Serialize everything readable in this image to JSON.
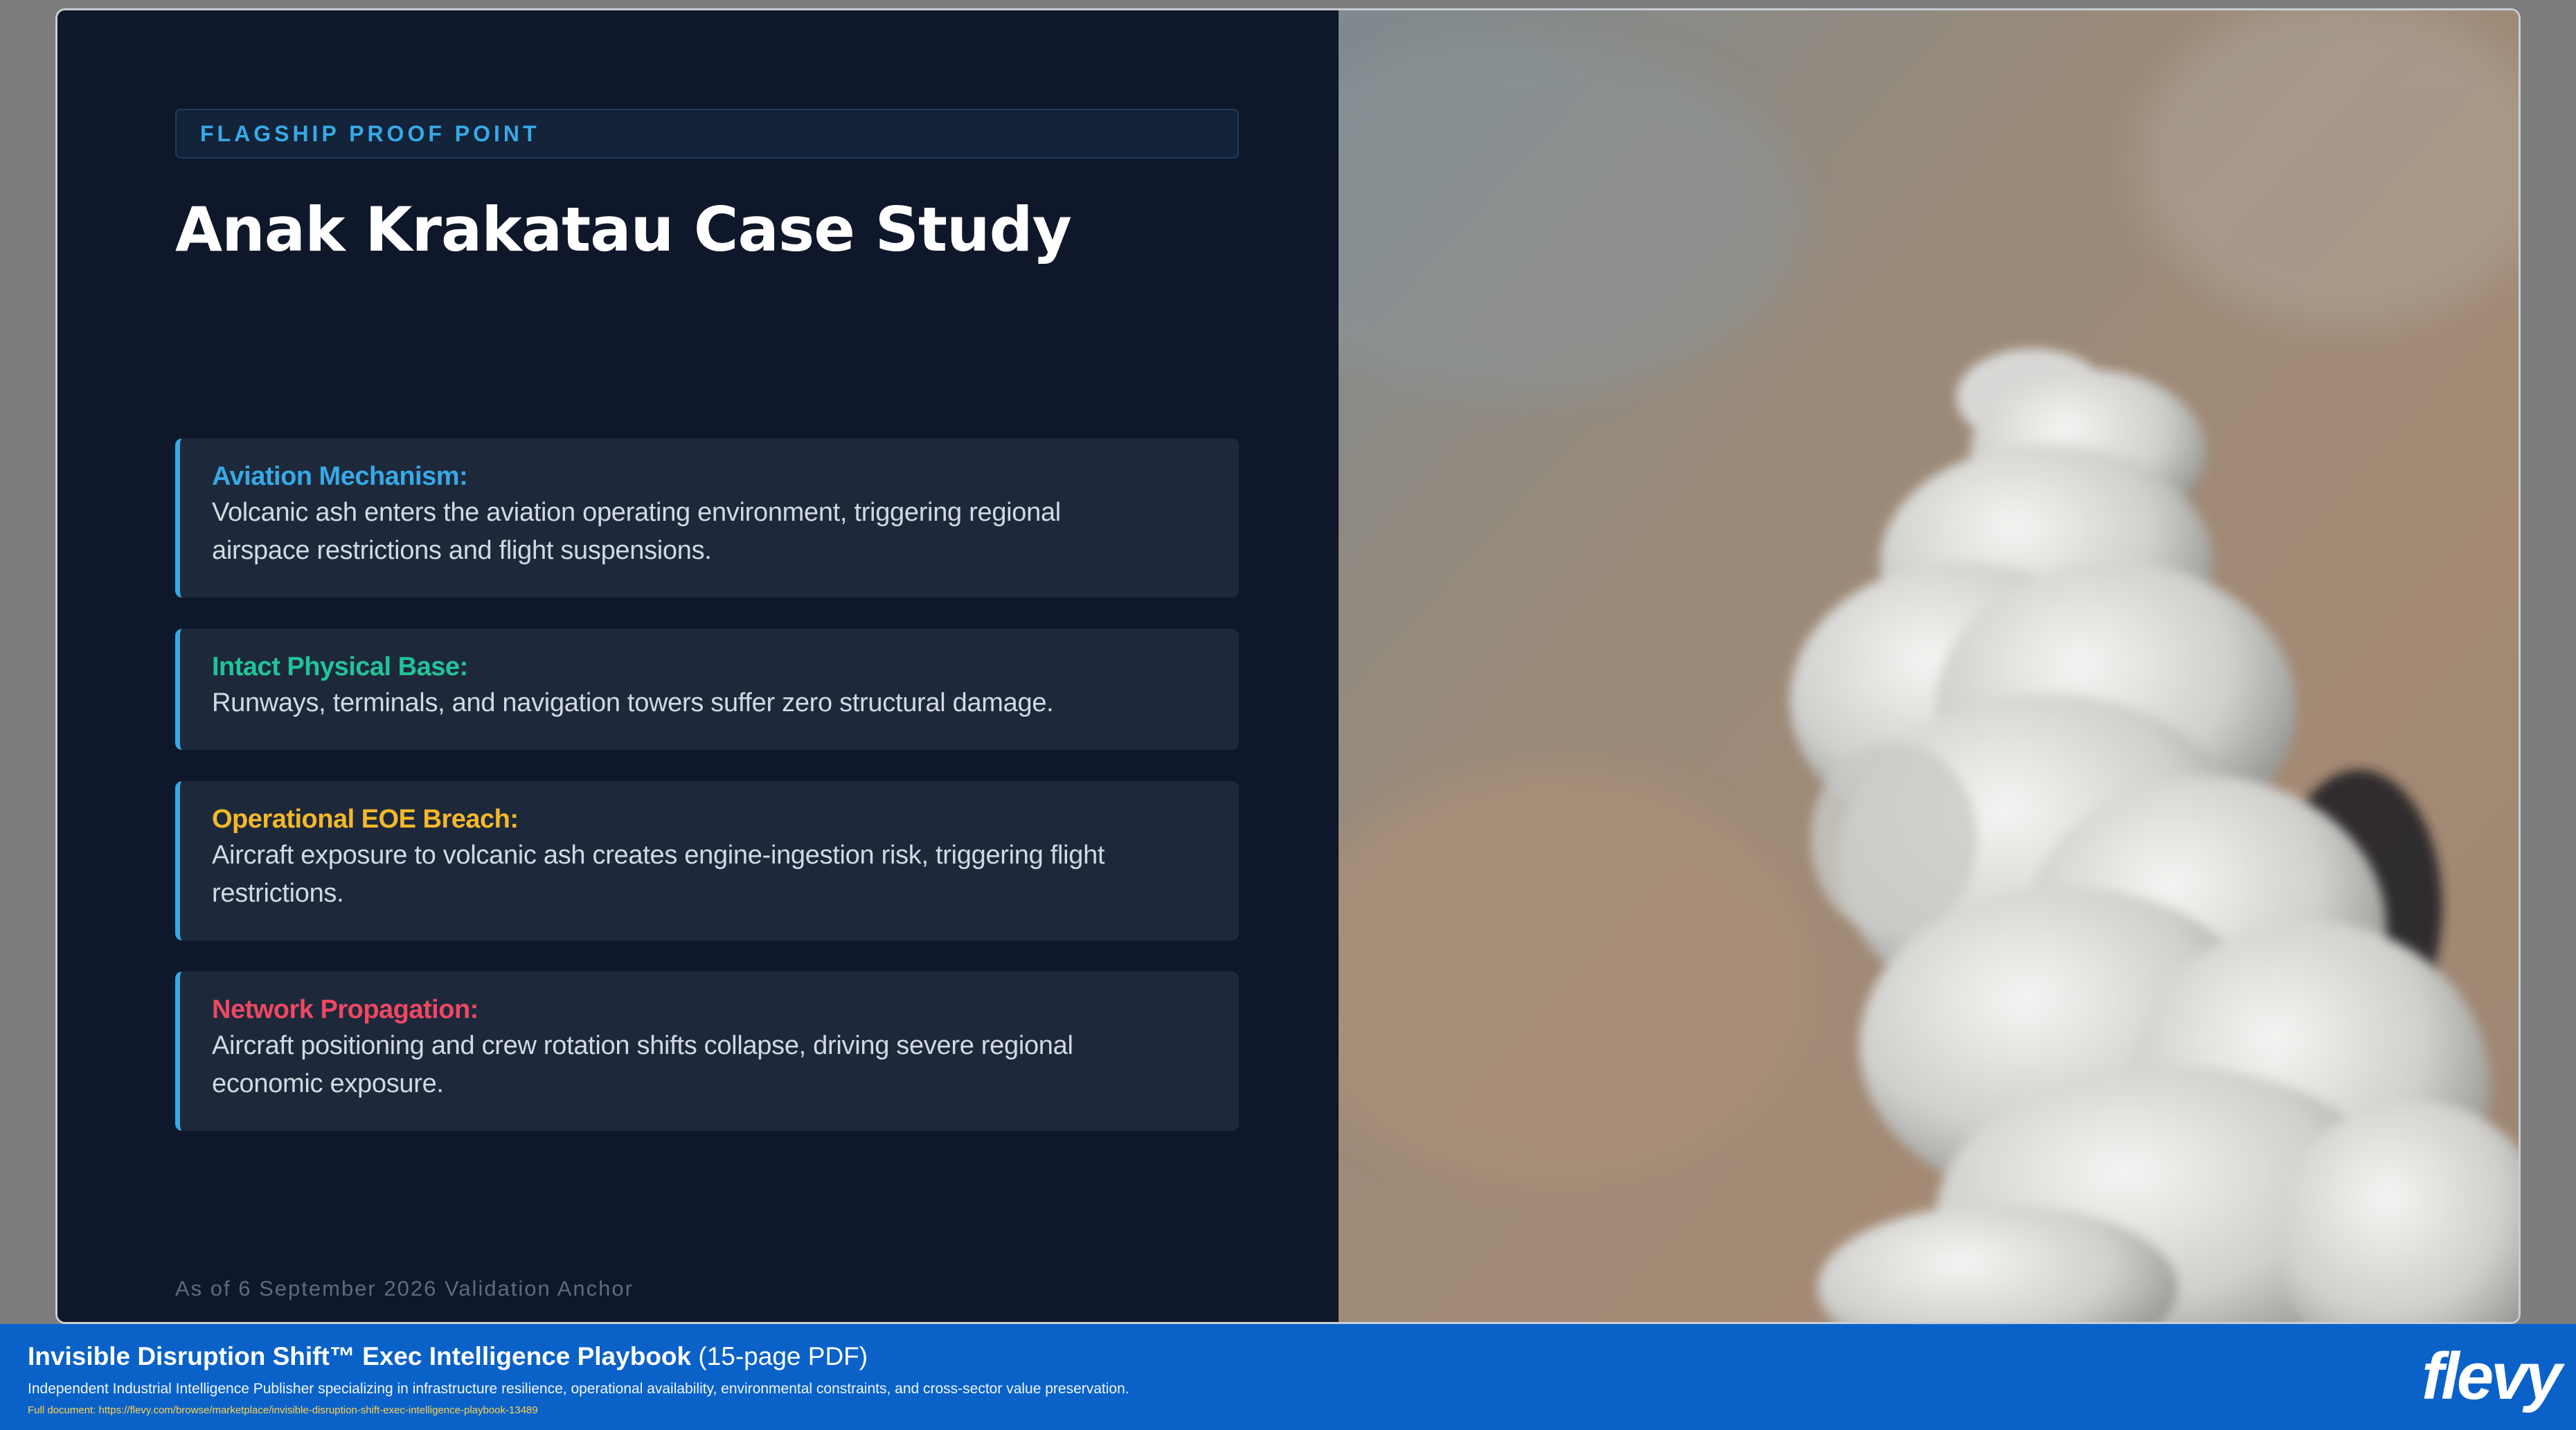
{
  "slide": {
    "eyebrow": "FLAGSHIP PROOF POINT",
    "title": "Anak Krakatau Case Study",
    "cards": [
      {
        "label": "Aviation Mechanism:",
        "label_color": "#38a9e6",
        "body_line1": "Volcanic ash enters the aviation operating environment, triggering regional",
        "body_line2": "airspace restrictions and flight suspensions."
      },
      {
        "label": "Intact Physical Base:",
        "label_color": "#22c39a",
        "body_line1": "Runways, terminals, and navigation towers suffer zero structural damage.",
        "body_line2": ""
      },
      {
        "label": "Operational EOE Breach:",
        "label_color": "#f5b829",
        "body_line1": "Aircraft exposure to volcanic ash creates engine-ingestion risk, triggering flight",
        "body_line2": "restrictions."
      },
      {
        "label": "Network Propagation:",
        "label_color": "#f04763",
        "body_line1": "Aircraft positioning and crew rotation shifts collapse, driving severe regional",
        "body_line2": "economic exposure."
      }
    ],
    "footnote": "As of 6 September 2026 Validation Anchor",
    "image_name": "volcanic-ash-plume-satellite-photo"
  },
  "banner": {
    "title_strong": "Invisible Disruption Shift™ Exec Intelligence Playbook",
    "title_suffix": " (15-page PDF)",
    "subtitle": "Independent Industrial Intelligence Publisher specializing in infrastructure resilience, operational availability, environmental constraints, and cross-sector value preservation.",
    "link": "Full document: https://flevy.com/browse/marketplace/invisible-disruption-shift-exec-intelligence-playbook-13489",
    "logo": "flevy"
  }
}
